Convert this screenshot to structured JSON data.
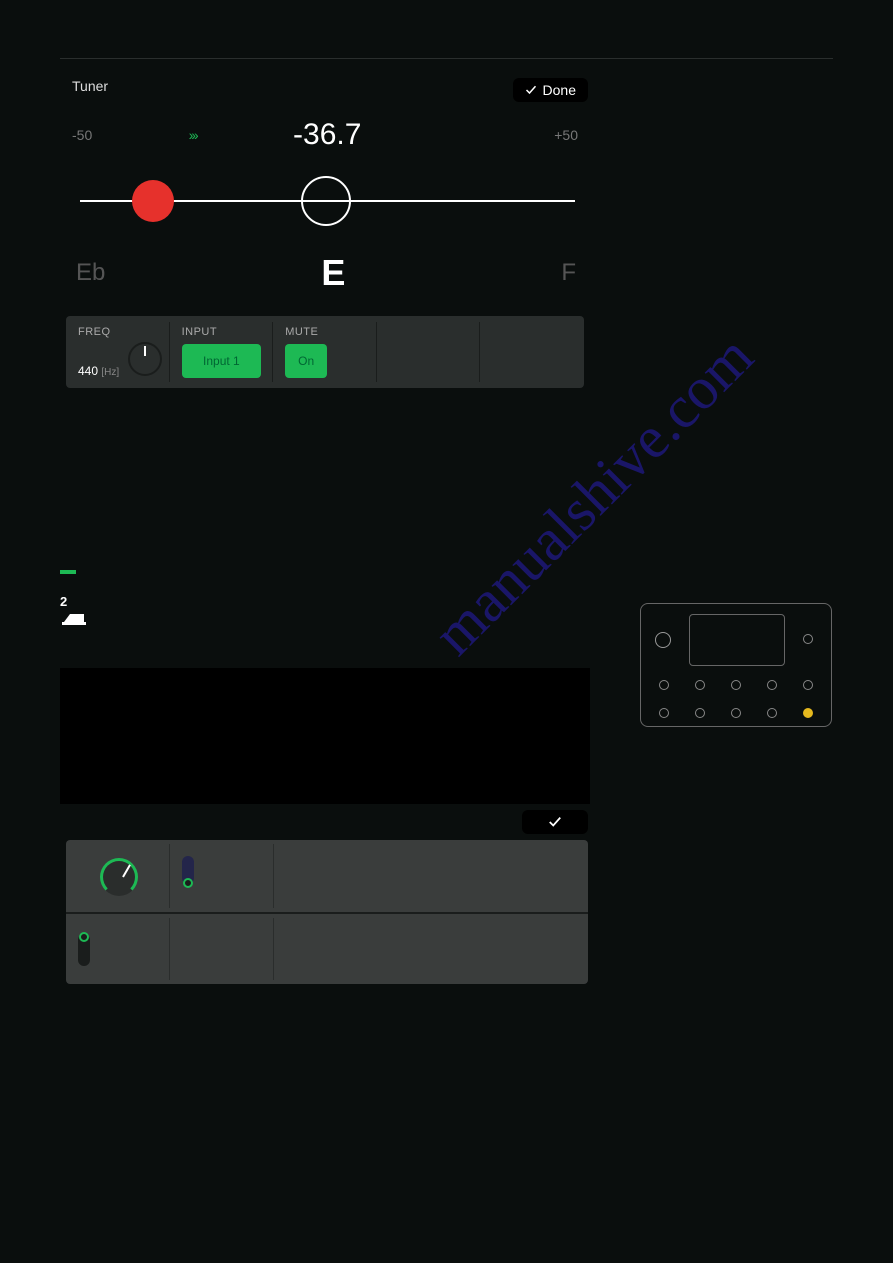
{
  "header": {
    "title": "Tuner",
    "done_label": "Done"
  },
  "tuner": {
    "min_label": "-50",
    "max_label": "+50",
    "cents_value": "-36.7",
    "note_left": "Eb",
    "note_center": "E",
    "note_right": "F"
  },
  "controls": {
    "freq": {
      "label": "FREQ",
      "value": "440",
      "unit": "[Hz]"
    },
    "input": {
      "label": "INPUT",
      "value": "Input 1"
    },
    "mute": {
      "label": "MUTE",
      "value": "On"
    }
  },
  "lower": {
    "step": "2"
  },
  "watermark": "manualshive.com",
  "colors": {
    "accent": "#1db954",
    "error": "#e6312c",
    "highlight": "#e6b91e"
  }
}
